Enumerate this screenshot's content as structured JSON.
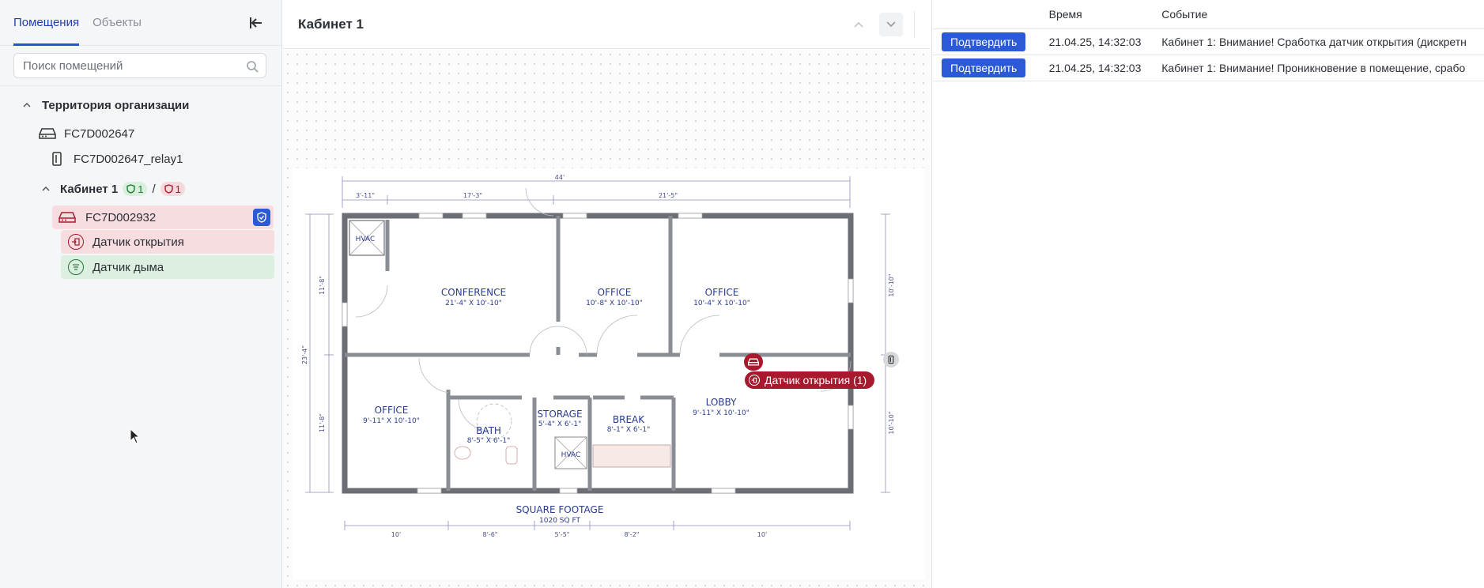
{
  "sidebar": {
    "tabs": [
      "Помещения",
      "Объекты"
    ],
    "search_placeholder": "Поиск помещений",
    "tree": {
      "root": "Территория организации",
      "device1": "FC7D002647",
      "relay": "FC7D002647_relay1",
      "room": "Кабинет 1",
      "badge_green": "1",
      "badge_sep": "/",
      "badge_red": "1",
      "device2": "FC7D002932",
      "sensor_open": "Датчик открытия",
      "sensor_smoke": "Датчик дыма"
    }
  },
  "center": {
    "title": "Кабинет 1",
    "map_sensor_label": "Датчик открытия (1)",
    "plan": {
      "rooms": [
        {
          "name": "CONFERENCE",
          "size": "21'-4\" X 10'-10\""
        },
        {
          "name": "OFFICE",
          "size": "10'-8\" X 10'-10\""
        },
        {
          "name": "OFFICE",
          "size": "10'-4\" X 10'-10\""
        },
        {
          "name": "OFFICE",
          "size": "9'-11\" X 10'-10\""
        },
        {
          "name": "BATH",
          "size": "8'-5\" X 6'-1\""
        },
        {
          "name": "STORAGE",
          "size": "5'-4\" X 6'-1\""
        },
        {
          "name": "BREAK",
          "size": "8'-1\" X 6'-1\""
        },
        {
          "name": "LOBBY",
          "size": "9'-11\" X 10'-10\""
        }
      ],
      "hvac": "HVAC",
      "dims_top": [
        "3'-11\"",
        "17'-3\"",
        "44'",
        "21'-5\""
      ],
      "dims_bottom": [
        "10'",
        "8'-6\"",
        "5'-5\"",
        "8'-2\"",
        "10'"
      ],
      "dims_left": [
        "11'-8\"",
        "23'-4\"",
        "11'-8\""
      ],
      "dims_right": [
        "10'-10\"",
        "10'-10\""
      ],
      "footage_title": "SQUARE FOOTAGE",
      "footage_value": "1020 SQ FT"
    }
  },
  "events": {
    "columns": [
      "",
      "Время",
      "Событие"
    ],
    "rows": [
      {
        "action": "Подтвердить",
        "time": "21.04.25, 14:32:03",
        "event": "Кабинет 1: Внимание! Сработка датчик открытия (дискретн"
      },
      {
        "action": "Подтвердить",
        "time": "21.04.25, 14:32:03",
        "event": "Кабинет 1: Внимание! Проникновение в помещение, срабо"
      }
    ]
  },
  "colors": {
    "accent": "#2c5ad6",
    "alarm": "#a8192e",
    "ok": "#1f7a35"
  }
}
